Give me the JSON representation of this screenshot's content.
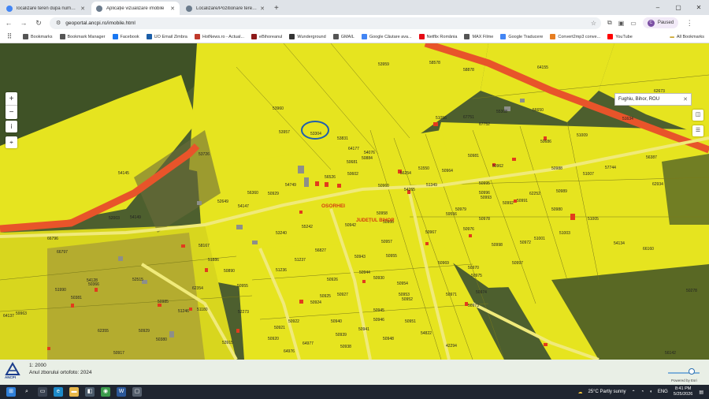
{
  "browser": {
    "tabs": [
      {
        "label": "localizare teren dupa numar cad",
        "active": false,
        "icon_color": "#4285f4"
      },
      {
        "label": "Aplicație vizualizare imobile",
        "active": true,
        "icon_color": "#6b7b8c"
      },
      {
        "label": "Localizare/Pozitionare teren - F",
        "active": false,
        "icon_color": "#6b7b8c"
      }
    ],
    "new_tab": "+",
    "url": "geoportal.ancpi.ro/imobile.html",
    "profile_initial": "C",
    "profile_status": "Paused",
    "window_controls": [
      "–",
      "▢",
      "✕"
    ]
  },
  "bookmarks": [
    {
      "label": "Bookmarks",
      "icon": "star-icon",
      "color": "#555555"
    },
    {
      "label": "Bookmark Manager",
      "icon": "star-icon",
      "color": "#555555"
    },
    {
      "label": "Facebook",
      "icon": "facebook-icon",
      "color": "#1877f2"
    },
    {
      "label": "UO Email Zimbra",
      "icon": "zimbra-icon",
      "color": "#1b5ea8"
    },
    {
      "label": "HotNews.ro - Actual...",
      "icon": "hotnews-icon",
      "color": "#c0392b"
    },
    {
      "label": "eBihoreanul",
      "icon": "ebihoreanul-icon",
      "color": "#8e1a1a"
    },
    {
      "label": "Wunderground",
      "icon": "wunderground-icon",
      "color": "#333333"
    },
    {
      "label": "GMAIL",
      "icon": "gmail-icon",
      "color": "#555555"
    },
    {
      "label": "Google Căutare ava...",
      "icon": "google-icon",
      "color": "#4285f4"
    },
    {
      "label": "Netflix România",
      "icon": "netflix-icon",
      "color": "#e50914"
    },
    {
      "label": "MAX Filme",
      "icon": "max-icon",
      "color": "#555555"
    },
    {
      "label": "Google Traducere",
      "icon": "translate-icon",
      "color": "#4285f4"
    },
    {
      "label": "Convert2mp3 conve...",
      "icon": "convert-icon",
      "color": "#e67e22"
    },
    {
      "label": "YouTube",
      "icon": "youtube-icon",
      "color": "#ff0000"
    }
  ],
  "all_bookmarks": "All Bookmarks",
  "map": {
    "search_value": "Fughiu, Bihor, ROU",
    "town_label": "OSORHEI",
    "county_label": "JUDEȚUL BIHOR",
    "colors": {
      "parcel": "#e6e41f",
      "road": "#e8542a",
      "imagery": "#3f5226"
    },
    "parcels": [
      {
        "id": "53959"
      },
      {
        "id": "58578"
      },
      {
        "id": "58878"
      },
      {
        "id": "64155"
      },
      {
        "id": "62673"
      },
      {
        "id": "53960"
      },
      {
        "id": "53957"
      },
      {
        "id": "53304"
      },
      {
        "id": "53831"
      },
      {
        "id": "51056"
      },
      {
        "id": "67751"
      },
      {
        "id": "67752"
      },
      {
        "id": "55308"
      },
      {
        "id": "56650"
      },
      {
        "id": "51634"
      },
      {
        "id": "53726"
      },
      {
        "id": "64177"
      },
      {
        "id": "54076"
      },
      {
        "id": "50884"
      },
      {
        "id": "50681"
      },
      {
        "id": "54145"
      },
      {
        "id": "50686"
      },
      {
        "id": "51009"
      },
      {
        "id": "56387"
      },
      {
        "id": "50981"
      },
      {
        "id": "50962"
      },
      {
        "id": "50988"
      },
      {
        "id": "57744"
      },
      {
        "id": "51007"
      },
      {
        "id": "51550"
      },
      {
        "id": "50964"
      },
      {
        "id": "56526"
      },
      {
        "id": "50602"
      },
      {
        "id": "56254"
      },
      {
        "id": "50995"
      },
      {
        "id": "62934"
      },
      {
        "id": "54749"
      },
      {
        "id": "56360"
      },
      {
        "id": "50929"
      },
      {
        "id": "50960"
      },
      {
        "id": "54265"
      },
      {
        "id": "51349"
      },
      {
        "id": "50996"
      },
      {
        "id": "62252"
      },
      {
        "id": "50989"
      },
      {
        "id": "52649"
      },
      {
        "id": "54147"
      },
      {
        "id": "50991"
      },
      {
        "id": "50992"
      },
      {
        "id": "50980"
      },
      {
        "id": "52003"
      },
      {
        "id": "54149"
      },
      {
        "id": "50958"
      },
      {
        "id": "50979"
      },
      {
        "id": "50993"
      },
      {
        "id": "51005"
      },
      {
        "id": "50942"
      },
      {
        "id": "50956"
      },
      {
        "id": "59556"
      },
      {
        "id": "50978"
      },
      {
        "id": "55242"
      },
      {
        "id": "53240"
      },
      {
        "id": "50967"
      },
      {
        "id": "51001"
      },
      {
        "id": "51003"
      },
      {
        "id": "66796"
      },
      {
        "id": "50957"
      },
      {
        "id": "50976"
      },
      {
        "id": "50998"
      },
      {
        "id": "54134"
      },
      {
        "id": "50972"
      },
      {
        "id": "58167"
      },
      {
        "id": "56827"
      },
      {
        "id": "50943"
      },
      {
        "id": "50955"
      },
      {
        "id": "50997"
      },
      {
        "id": "66160"
      },
      {
        "id": "66797"
      },
      {
        "id": "51886"
      },
      {
        "id": "51237"
      },
      {
        "id": "50969"
      },
      {
        "id": "50970"
      },
      {
        "id": "54128"
      },
      {
        "id": "52515"
      },
      {
        "id": "50890"
      },
      {
        "id": "51236"
      },
      {
        "id": "50944"
      },
      {
        "id": "50930"
      },
      {
        "id": "50926"
      },
      {
        "id": "50954"
      },
      {
        "id": "50975"
      },
      {
        "id": "50366"
      },
      {
        "id": "51990"
      },
      {
        "id": "62354"
      },
      {
        "id": "50955"
      },
      {
        "id": "50925"
      },
      {
        "id": "50927"
      },
      {
        "id": "50953"
      },
      {
        "id": "50971"
      },
      {
        "id": "50974"
      },
      {
        "id": "50278"
      },
      {
        "id": "50381"
      },
      {
        "id": "50985"
      },
      {
        "id": "51246"
      },
      {
        "id": "51180"
      },
      {
        "id": "52273"
      },
      {
        "id": "50924"
      },
      {
        "id": "50945"
      },
      {
        "id": "50952"
      },
      {
        "id": "50973"
      },
      {
        "id": "59963"
      },
      {
        "id": "64137"
      },
      {
        "id": "50922"
      },
      {
        "id": "50940"
      },
      {
        "id": "50946"
      },
      {
        "id": "50951"
      },
      {
        "id": "62355"
      },
      {
        "id": "50929"
      },
      {
        "id": "50921"
      },
      {
        "id": "50941"
      },
      {
        "id": "54822"
      },
      {
        "id": "50380"
      },
      {
        "id": "53915"
      },
      {
        "id": "50920"
      },
      {
        "id": "50939"
      },
      {
        "id": "50948"
      },
      {
        "id": "50917"
      },
      {
        "id": "64976"
      },
      {
        "id": "64977"
      },
      {
        "id": "50938"
      },
      {
        "id": "42294"
      },
      {
        "id": "56142"
      }
    ]
  },
  "footer": {
    "logo_text": "ANCPI",
    "scale": "1: 2000",
    "orthophoto": "Anul zborului ortofoto: 2024",
    "attribution": "Powered by Esri"
  },
  "taskbar": {
    "weather": "25°C  Partly sunny",
    "lang": "ENG",
    "time": "8:41 PM",
    "date": "5/25/2026"
  }
}
